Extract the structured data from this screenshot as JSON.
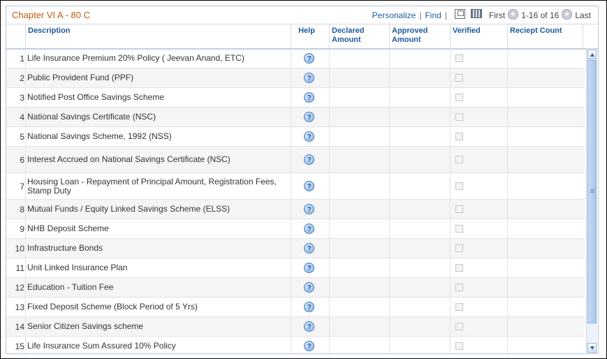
{
  "grid": {
    "title": "Chapter VI A - 80 C",
    "nav": {
      "personalize": "Personalize",
      "separator": "|",
      "find": "Find",
      "first": "First",
      "range": "1-16 of 16",
      "last": "Last"
    },
    "columns": {
      "description": "Description",
      "help": "Help",
      "declared_amount": "Declared Amount",
      "approved_amount": "Approved Amount",
      "verified": "Verified",
      "receipt_count": "Reciept Count"
    },
    "help_glyph": "?",
    "rows": [
      {
        "num": "1",
        "description": "Life Insurance Premium 20% Policy ( Jeevan Anand, ETC)"
      },
      {
        "num": "2",
        "description": "Public Provident Fund (PPF)"
      },
      {
        "num": "3",
        "description": "Notified Post Office Savings Scheme"
      },
      {
        "num": "4",
        "description": "National Savings Certificate (NSC)"
      },
      {
        "num": "5",
        "description": "National Savings Scheme, 1992 (NSS)"
      },
      {
        "num": "6",
        "description": "Interest Accrued on National Savings Certificate (NSC)"
      },
      {
        "num": "7",
        "description": "Housing Loan - Repayment of Principal Amount, Registration Fees, Stamp Duty"
      },
      {
        "num": "8",
        "description": "Mutual Funds / Equity Linked Savings Scheme (ELSS)"
      },
      {
        "num": "9",
        "description": "NHB Deposit Scheme"
      },
      {
        "num": "10",
        "description": "Infrastructure Bonds"
      },
      {
        "num": "11",
        "description": "Unit Linked Insurance Plan"
      },
      {
        "num": "12",
        "description": "Education - Tuition Fee"
      },
      {
        "num": "13",
        "description": "Fixed Deposit Scheme (Block Period of 5 Yrs)"
      },
      {
        "num": "14",
        "description": "Senior Citizen Savings scheme"
      },
      {
        "num": "15",
        "description": "Life Insurance Sum Assured 10% Policy"
      }
    ],
    "colors": {
      "title": "#c05a10",
      "link": "#1d5c9c",
      "header_text": "#1d5c9c"
    }
  }
}
